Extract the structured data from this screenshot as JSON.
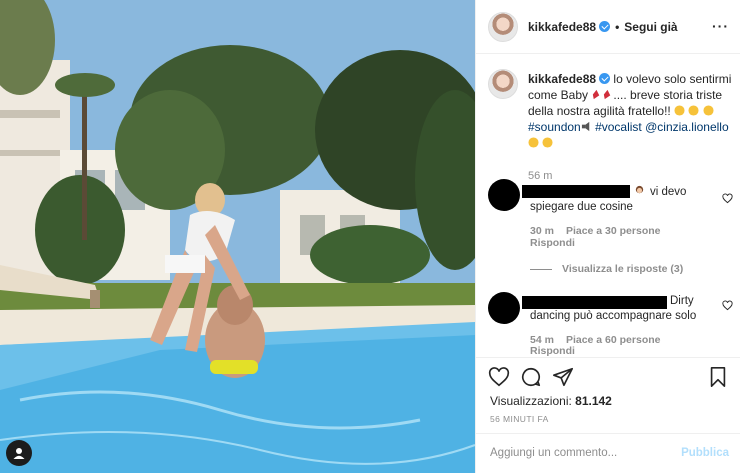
{
  "post": {
    "username": "kikkafede88",
    "header_separator": "•",
    "follow_label": "Segui già",
    "more_label": "···"
  },
  "caption": {
    "username": "kikkafede88",
    "text_1": " lo volevo solo sentirmi come Baby ",
    "text_2": ".... breve storia triste della nostra agilità fratello!! ",
    "hashtag_1": "#soundon",
    "hashtag_2": "#vocalist",
    "mention": "@cinzia.lionello",
    "time": "56 m"
  },
  "comments": [
    {
      "text": "vi devo spiegare due cosine",
      "time": "30 m",
      "likes": "Piace a 30 persone",
      "reply_label": "Rispondi"
    },
    {
      "text": "Dirty dancing può accompagnare solo",
      "time": "54 m",
      "likes": "Piace a 60 persone",
      "reply_label": "Rispondi"
    }
  ],
  "view_replies_label": "Visualizza le risposte (3)",
  "stats": {
    "views_label": "Visualizzazioni: ",
    "views_count": "81.142",
    "time_ago": "56 MINUTI FA"
  },
  "add_comment": {
    "placeholder": "Aggiungi un commento...",
    "publish_label": "Pubblica"
  },
  "colors": {
    "link": "#00376b",
    "verified": "#3897f0",
    "publish_disabled": "#b2dffc",
    "muted": "#8e8e8e"
  },
  "icons": [
    "heart-icon",
    "comment-icon",
    "share-icon",
    "bookmark-icon",
    "verified-badge-icon",
    "more-options-icon"
  ]
}
